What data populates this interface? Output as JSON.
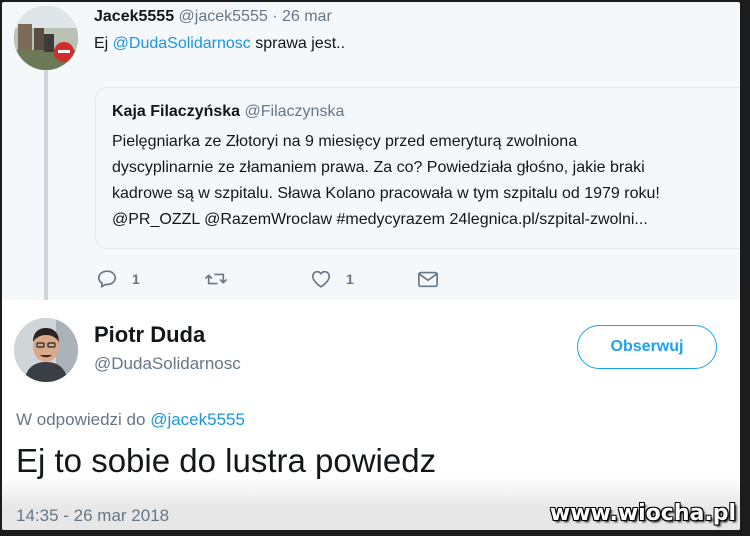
{
  "parent_tweet": {
    "author_name": "Jacek5555",
    "author_handle": "@jacek5555",
    "separator": "·",
    "date": "26 mar",
    "text_prefix": "Ej ",
    "text_mention": "@DudaSolidarnosc",
    "text_suffix": " sprawa jest..",
    "quoted": {
      "author_name": "Kaja Filaczyńska",
      "author_handle": "@Filaczynska",
      "lines": [
        "Pielęgniarka ze Złotoryi na 9 miesięcy przed emeryturą zwolniona",
        "dyscyplinarnie ze złamaniem prawa. Za co? Powiedziała głośno, jakie braki",
        "kadrowe są w szpitalu. Sława Kolano pracowała w tym szpitalu od 1979 roku!",
        "@PR_OZZL @RazemWroclaw #medycyrazem 24legnica.pl/szpital-zwolni..."
      ]
    },
    "actions": {
      "reply_count": "1",
      "retweet_count": "",
      "like_count": "1"
    }
  },
  "main_tweet": {
    "author_name": "Piotr Duda",
    "author_handle": "@DudaSolidarnosc",
    "follow_label": "Obserwuj",
    "reply_to_prefix": "W odpowiedzi do ",
    "reply_to_mention": "@jacek5555",
    "text": "Ej to sobie do lustra powiedz",
    "timestamp": "14:35 - 26 mar 2018"
  },
  "watermark": "www.wiocha.pl",
  "colors": {
    "accent": "#1da1f2",
    "mention": "#1b95e0",
    "secondary_text": "#657786",
    "parent_background": "#f5f8fa"
  },
  "icons": [
    "reply-icon",
    "retweet-icon",
    "like-icon",
    "direct-message-icon"
  ]
}
